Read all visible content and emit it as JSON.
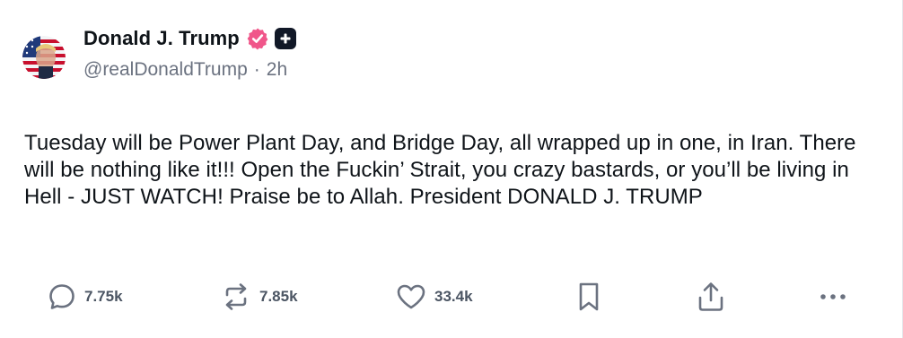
{
  "post": {
    "author": {
      "name": "Donald J. Trump",
      "handle": "@realDonaldTrump",
      "separator": "·",
      "time": "2h",
      "avatar_icon": "avatar-flag-portrait",
      "verified_icon": "verified-badge-icon",
      "plus_icon": "plus-badge-icon"
    },
    "text": "Tuesday will be Power Plant Day, and Bridge Day, all wrapped up in one, in Iran. There will be nothing like it!!! Open the Fuckin’ Strait, you crazy bastards, or you’ll be living in Hell - JUST WATCH! Praise be to Allah. President DONALD J. TRUMP",
    "actions": {
      "replies": "7.75k",
      "reposts": "7.85k",
      "likes": "33.4k"
    }
  },
  "colors": {
    "verified": "#f0568a",
    "plus_badge": "#111827",
    "muted_text": "#6b7280",
    "icon": "#6b7280"
  }
}
